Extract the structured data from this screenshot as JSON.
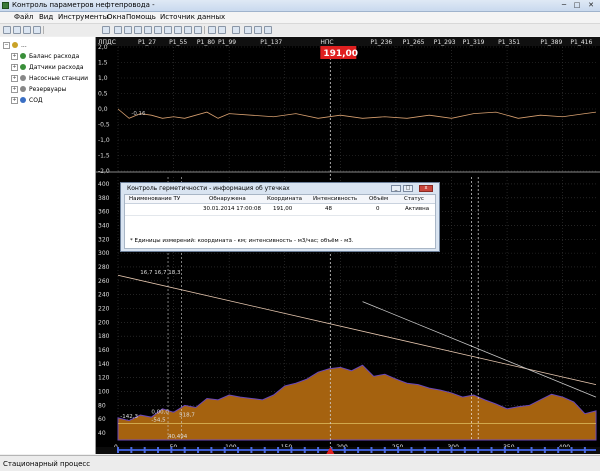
{
  "window": {
    "title": "Контроль параметров нефтепровода -",
    "minimize": "─",
    "maximize": "□",
    "close": "✕"
  },
  "menu": [
    "Файл",
    "Вид",
    "Инструменты",
    "Окна",
    "Помощь",
    "Источник данных"
  ],
  "toolbar_icons": [
    "open-icon",
    "save-icon",
    "print-icon",
    "grid-icon",
    "chart-icon",
    "zoom-in-icon",
    "zoom-out-icon",
    "zoom-fit-icon",
    "zoom-area-icon",
    "zoom-x-icon",
    "zoom-y-icon",
    "refresh-icon",
    "settings-icon",
    "export-icon",
    "table-icon",
    "help-icon"
  ],
  "tree": {
    "root": "...",
    "items": [
      {
        "label": "Баланс расхода",
        "color": "#3a8f3a"
      },
      {
        "label": "Датчики расхода",
        "color": "#3a8f3a"
      },
      {
        "label": "Насосные станции",
        "color": "#888888"
      },
      {
        "label": "Резервуары",
        "color": "#888888"
      },
      {
        "label": "СОД",
        "color": "#3a6fc4"
      }
    ]
  },
  "top_axis_labels": [
    {
      "text": "ЛПДС",
      "km": 0
    },
    {
      "text": "P1_27",
      "km": 27
    },
    {
      "text": "P1_55",
      "km": 55
    },
    {
      "text": "P1_80",
      "km": 80
    },
    {
      "text": "P1_99",
      "km": 99
    },
    {
      "text": "P1_137",
      "km": 137
    },
    {
      "text": "НПС",
      "km": 191
    },
    {
      "text": "P1_236",
      "km": 236
    },
    {
      "text": "P1_265",
      "km": 265
    },
    {
      "text": "P1_293",
      "km": 293
    },
    {
      "text": "P1_319",
      "km": 319
    },
    {
      "text": "P1_351",
      "km": 351
    },
    {
      "text": "P1_389",
      "km": 389
    },
    {
      "text": "P1_416",
      "km": 416
    }
  ],
  "cursor": {
    "label": "191,00",
    "km": 191,
    "color": "#e02020"
  },
  "chart_data": [
    {
      "type": "line",
      "yticks": [
        "2,0",
        "1,5",
        "1,0",
        "0,5",
        "0,0",
        "-0,5",
        "-1,0",
        "-1,5",
        "-2,0"
      ],
      "ylim": [
        -2.0,
        2.0
      ],
      "annotation": "-0,16",
      "series": [
        {
          "color": "#d8a070",
          "x": [
            0,
            10,
            20,
            30,
            40,
            50,
            60,
            80,
            90,
            100,
            120,
            140,
            160,
            180,
            200,
            220,
            240,
            260,
            280,
            300,
            320,
            340,
            360,
            380,
            400,
            420,
            430
          ],
          "y": [
            0.0,
            -0.3,
            -0.15,
            -0.2,
            -0.3,
            -0.25,
            -0.3,
            -0.1,
            -0.3,
            -0.15,
            -0.2,
            -0.25,
            -0.15,
            -0.3,
            -0.2,
            -0.3,
            -0.25,
            -0.3,
            -0.2,
            -0.3,
            -0.15,
            -0.1,
            -0.3,
            -0.2,
            -0.25,
            -0.15,
            -0.1
          ]
        }
      ]
    },
    {
      "type": "area",
      "yticks": [
        "400",
        "380",
        "360",
        "340",
        "320",
        "300",
        "280",
        "260",
        "240",
        "220",
        "200",
        "180",
        "160",
        "140",
        "120",
        "100",
        "80",
        "60",
        "40"
      ],
      "xticks": [
        "0",
        "50",
        "100",
        "150",
        "200",
        "250",
        "300",
        "350",
        "400"
      ],
      "ylim": [
        30,
        410
      ],
      "xlim": [
        0,
        430
      ],
      "annotations": [
        "16,7",
        "16,7",
        "18,3",
        "-142,3",
        "0,00,0",
        "518,7",
        "-54,5",
        "40,494"
      ],
      "profile": {
        "color": "#a5620f",
        "x": [
          0,
          10,
          20,
          30,
          40,
          50,
          60,
          70,
          80,
          90,
          100,
          110,
          120,
          130,
          140,
          150,
          160,
          170,
          180,
          190,
          200,
          210,
          220,
          230,
          240,
          250,
          260,
          270,
          280,
          290,
          300,
          310,
          320,
          330,
          340,
          350,
          360,
          370,
          380,
          390,
          400,
          410,
          420,
          430
        ],
        "y": [
          62,
          58,
          66,
          63,
          75,
          70,
          80,
          77,
          90,
          88,
          95,
          92,
          90,
          88,
          95,
          108,
          112,
          118,
          128,
          133,
          135,
          130,
          138,
          122,
          125,
          118,
          112,
          110,
          105,
          102,
          98,
          92,
          95,
          88,
          82,
          75,
          78,
          80,
          88,
          96,
          92,
          85,
          68,
          72
        ]
      },
      "pressure_lines": [
        {
          "color": "#e8c8b0",
          "x": [
            0,
            430
          ],
          "y": [
            268,
            110
          ]
        },
        {
          "color": "#c8c8c8",
          "x": [
            220,
            430
          ],
          "y": [
            230,
            92
          ]
        }
      ],
      "hline": {
        "y": 54,
        "color": "#e0c060"
      }
    }
  ],
  "dialog": {
    "title": "Контроль герметичности - информация об утечках",
    "headers": [
      "Наименование ТУ",
      "Обнаружена",
      "Координата",
      "Интенсивность",
      "Объём",
      "Статус"
    ],
    "row": [
      "",
      "30.01.2014 17:00:08",
      "191,00",
      "48",
      "0",
      "Активна"
    ],
    "note": "* Единицы измерений: координата - км; интенсивность - м3/час; объём - м3."
  },
  "status": "Стационарный процесс"
}
